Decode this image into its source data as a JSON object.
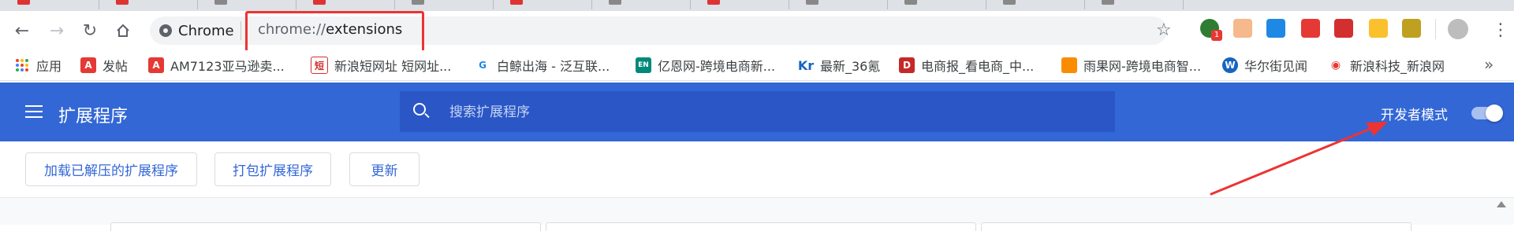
{
  "browser": {
    "omnibox_chip": "Chrome",
    "url_scheme": "chrome://",
    "url_host": "extensions"
  },
  "bookmarks": [
    {
      "label": "应用",
      "icon": "apps-grid-icon",
      "color": "#4285f4"
    },
    {
      "label": "发帖",
      "icon": "a-red-icon",
      "color": "#e53935"
    },
    {
      "label": "AM7123亚马逊卖...",
      "icon": "a-red-icon",
      "color": "#e53935"
    },
    {
      "label": "新浪短网址 短网址...",
      "icon": "sina-short-icon",
      "color": "#d32f2f"
    },
    {
      "label": "白鲸出海 - 泛互联...",
      "icon": "whale-icon",
      "color": "#1e88e5"
    },
    {
      "label": "亿恩网-跨境电商新...",
      "icon": "en-icon",
      "color": "#00897b"
    },
    {
      "label": "最新_36氪",
      "icon": "kr-icon",
      "color": "#1565c0"
    },
    {
      "label": "电商报_看电商_中...",
      "icon": "d-icon",
      "color": "#c62828"
    },
    {
      "label": "雨果网-跨境电商智...",
      "icon": "yuguo-icon",
      "color": "#fb8c00"
    },
    {
      "label": "华尔街见闻",
      "icon": "wallstreet-icon",
      "color": "#1565c0"
    },
    {
      "label": "新浪科技_新浪网",
      "icon": "weibo-icon",
      "color": "#e53935"
    }
  ],
  "header": {
    "title": "扩展程序",
    "search_placeholder": "搜索扩展程序",
    "dev_mode_label": "开发者模式",
    "dev_mode_on": true
  },
  "actions": {
    "load_unpacked": "加载已解压的扩展程序",
    "pack": "打包扩展程序",
    "update": "更新"
  },
  "extension_badge": "1",
  "colors": {
    "header_bg": "#3367d6",
    "search_bg": "#2a56c6",
    "annotation_red": "#e33333",
    "link_blue": "#3367d6"
  }
}
